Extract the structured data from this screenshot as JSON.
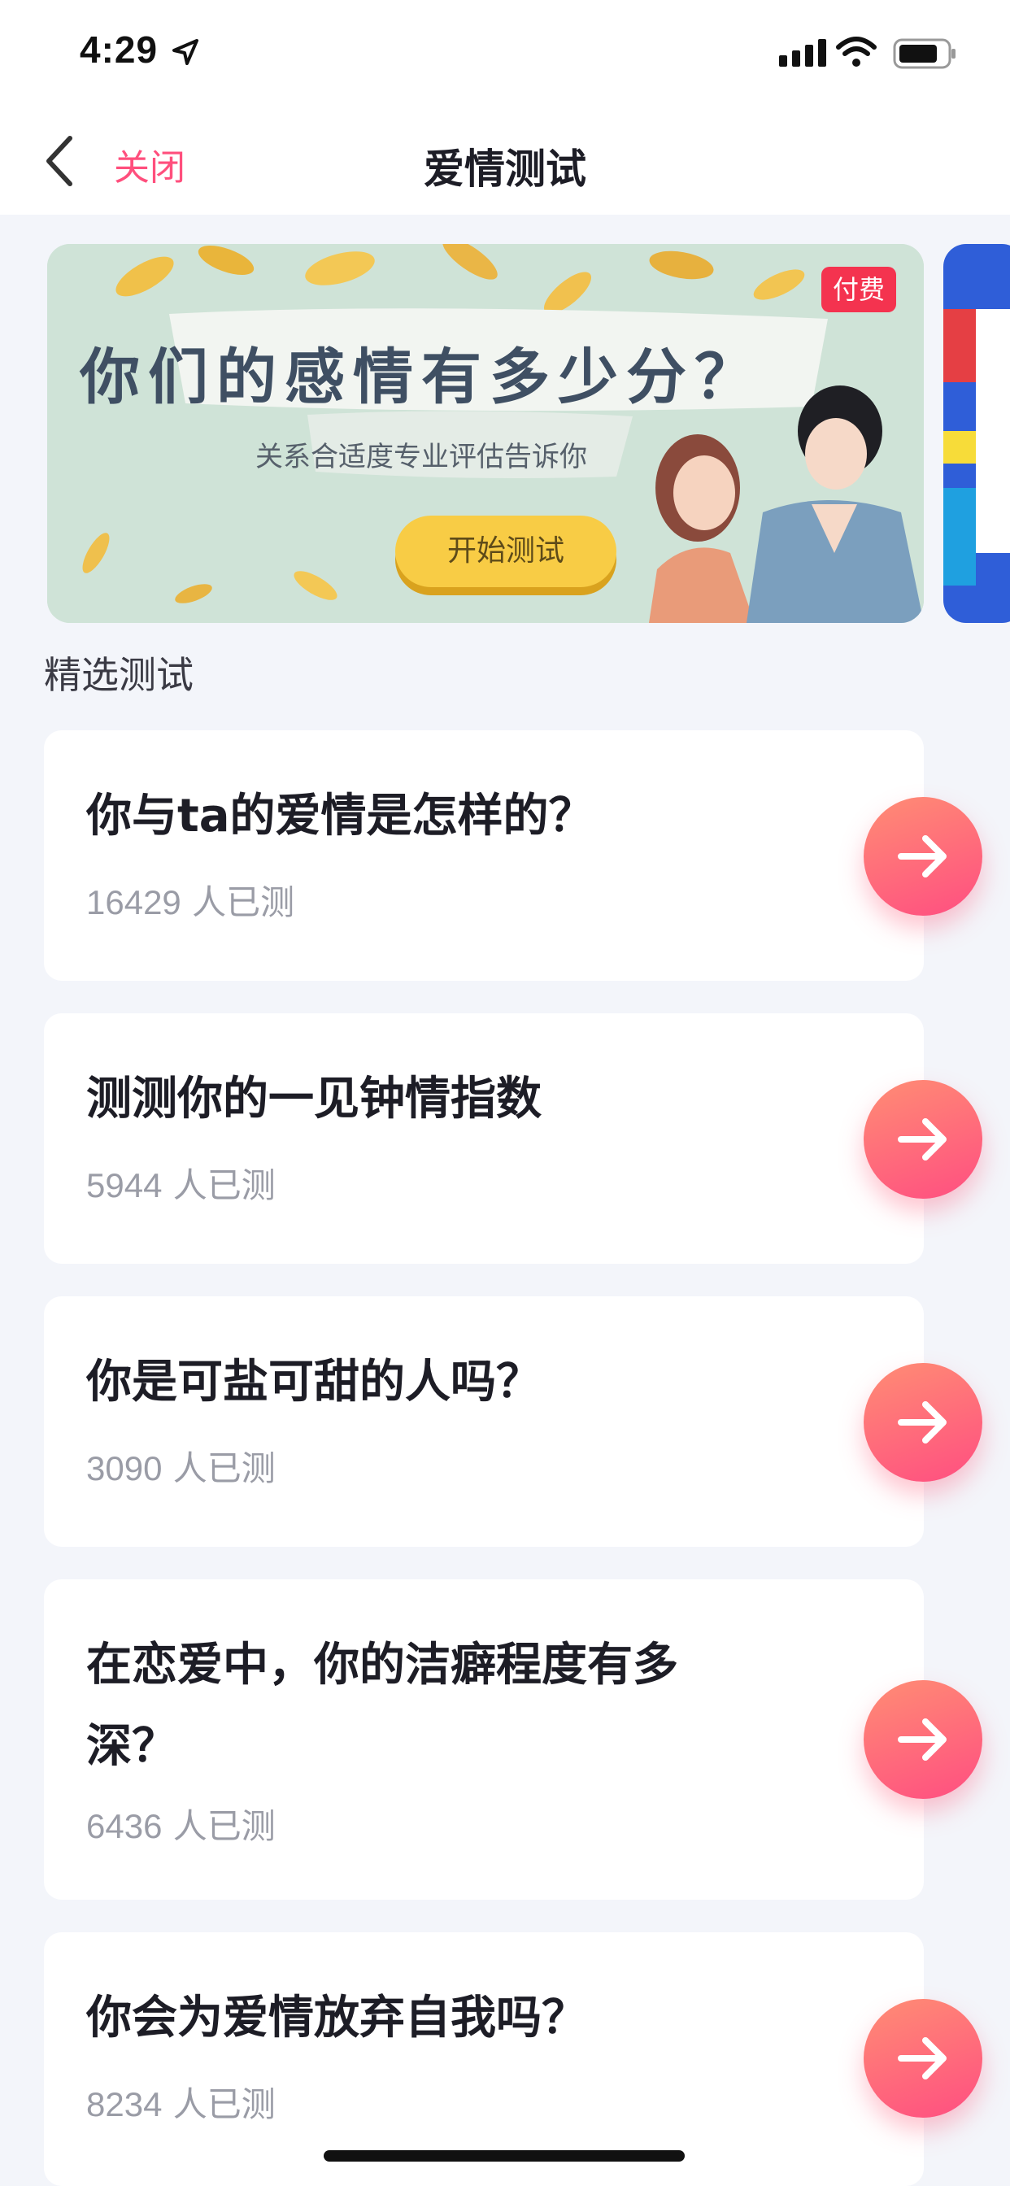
{
  "status_bar": {
    "time": "4:29",
    "icons": [
      "location-arrow-icon",
      "signal-icon",
      "wifi-icon",
      "battery-icon"
    ]
  },
  "nav": {
    "back_icon": "chevron-left-icon",
    "close_label": "关闭",
    "title": "爱情测试"
  },
  "banner": {
    "headline": "你们的感情有多少分？",
    "subtitle": "关系合适度专业评估告诉你",
    "button_label": "开始测试",
    "badge": "付费"
  },
  "section_title": "精选测试",
  "tests": [
    {
      "title": "你与ta的爱情是怎样的？",
      "count": "16429",
      "count_suffix": "人已测"
    },
    {
      "title": "测测你的一见钟情指数",
      "count": "5944",
      "count_suffix": "人已测"
    },
    {
      "title": "你是可盐可甜的人吗？",
      "count": "3090",
      "count_suffix": "人已测"
    },
    {
      "title_line1": "在恋爱中，你的洁癖程度有多",
      "title_line2": "深？",
      "count": "6436",
      "count_suffix": "人已测"
    },
    {
      "title": "你会为爱情放弃自我吗？",
      "count": "8234",
      "count_suffix": "人已测"
    }
  ],
  "colors": {
    "accent": "#ff4f7d",
    "page_bg": "#f3f5fa",
    "badge": "#f4334f",
    "button_yellow": "#f8cc45"
  }
}
